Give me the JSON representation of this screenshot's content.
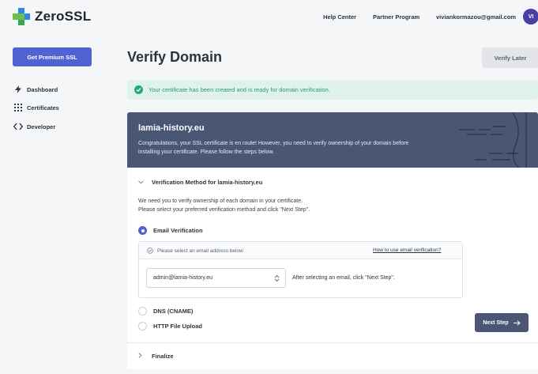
{
  "header": {
    "logo_text": "ZeroSSL",
    "nav": [
      "Help Center",
      "Partner Program"
    ],
    "user_email": "viviankormazou@gmail.com",
    "avatar_initials": "VI"
  },
  "sidebar": {
    "premium_button": "Get Premium SSL",
    "items": [
      {
        "label": "Dashboard",
        "icon": "bolt-icon"
      },
      {
        "label": "Certificates",
        "icon": "grid-icon"
      },
      {
        "label": "Developer",
        "icon": "code-icon"
      }
    ]
  },
  "main": {
    "title": "Verify Domain",
    "verify_later": "Verify Later",
    "alert": "Your certificate has been created and is ready for domain verification.",
    "banner": {
      "domain": "lamia-history.eu",
      "text": "Congratulations, your SSL certificate is en route! However, you need to verify ownership of your domain before installing your certificate. Please follow the steps below."
    },
    "method": {
      "heading": "Verification Method for lamia-history.eu",
      "desc_line1": "We need you to verify ownership of each domain in your certificate.",
      "desc_line2": "Please select your preferred verification method and click \"Next Step\".",
      "options": [
        {
          "label": "Email Verification",
          "selected": true
        },
        {
          "label": "DNS (CNAME)",
          "selected": false
        },
        {
          "label": "HTTP File Upload",
          "selected": false
        }
      ],
      "email_box": {
        "prompt": "Please select an email address below",
        "help_link": "How to use email verification?",
        "selected_email": "admin@lamia-history.eu",
        "after_text": "After selecting an email, click \"Next Step\"."
      },
      "next_button": "Next Step"
    },
    "finalize": "Finalize"
  },
  "colors": {
    "accent": "#4f63d2",
    "banner": "#4b5675",
    "success_bg": "#dff3ea",
    "success": "#2aa874"
  }
}
